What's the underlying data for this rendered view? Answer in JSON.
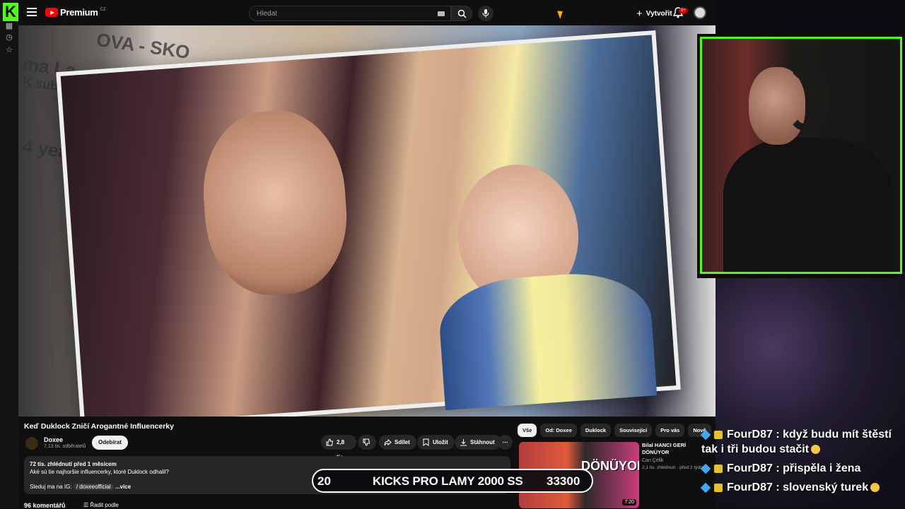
{
  "youtube": {
    "brand": "Premium",
    "brand_sup": "CZ",
    "search_placeholder": "Hledat",
    "create_label": "Vytvořit",
    "notifications_badge": "9+"
  },
  "video": {
    "bg_text": [
      "OVA - SKO",
      "ma La",
      "K subsc",
      "4 yea"
    ]
  },
  "info": {
    "title": "Keď Duklock Zničí Arogantné Influencerky",
    "channel": "Doxee",
    "subscribers": "7,13 tis. odběratelů",
    "subscribe_label": "Odebírat",
    "likes": "2,8 tis.",
    "share_label": "Sdílet",
    "save_label": "Uložit",
    "download_label": "Stáhnout",
    "desc_meta": "72 tis. zhlédnutí  před 1 měsícem",
    "desc_line": "Aké sú tie najhoršie influencerky, ktoré Duklock odhalil?",
    "desc_follow": "Sleduj ma na IG:",
    "desc_ig": "/ doxeeofficial",
    "desc_more": "...více",
    "comments": "96 komentářů",
    "sort_label": "Řadit podle"
  },
  "chips": [
    "Vše",
    "Od: Doxee",
    "Duklock",
    "Související",
    "Pro vás",
    "Nově"
  ],
  "recommended": {
    "title": "Bilal HANCI GERİ DÖNÜYOR",
    "channel": "Can Çelik",
    "meta": "2,1 tis. zhlédnutí · před 2 týdny",
    "thumb_text": "DÖNÜYOR",
    "duration": "7:20"
  },
  "goal": {
    "current": "20",
    "label": "KICKS PRO LAMY 2000 SS",
    "target": "33300"
  },
  "chat": [
    {
      "user": "FourD87",
      "text": ": když budu mít štěstí tak i tři budou stačit"
    },
    {
      "user": "FourD87",
      "text": ": přispěla i žena"
    },
    {
      "user": "FourD87",
      "text": ": slovenský turek"
    }
  ],
  "colors": {
    "kick_green": "#53fc18",
    "youtube_red": "#ff0000",
    "yt_bg": "#0f0f0f"
  }
}
